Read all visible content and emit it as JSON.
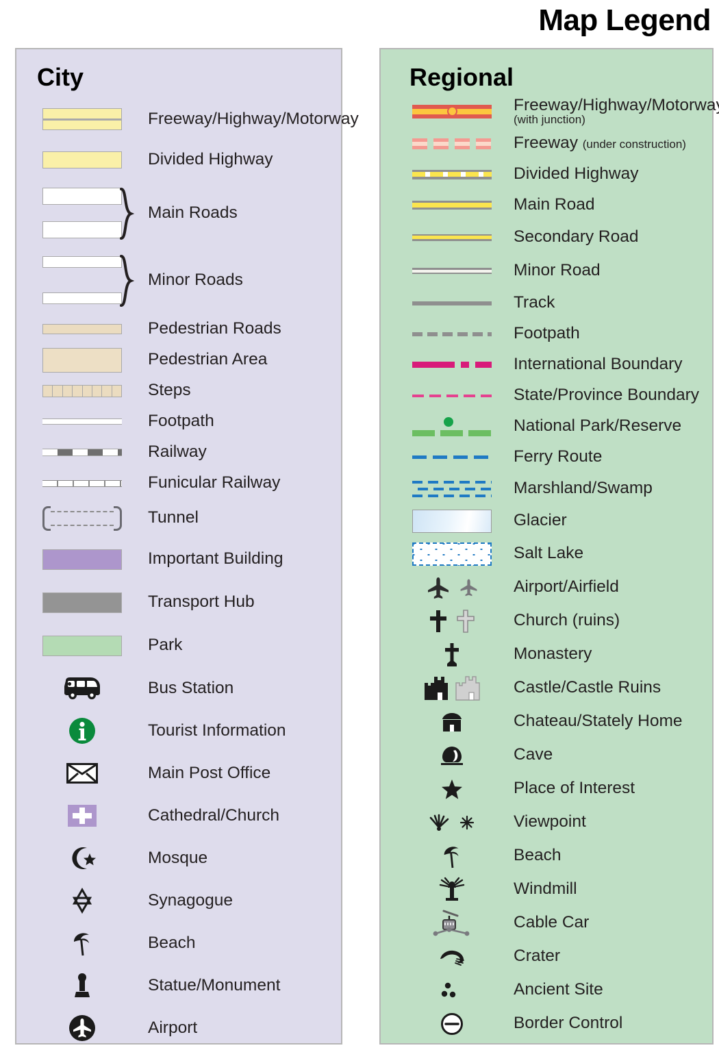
{
  "title": "Map Legend",
  "city": {
    "heading": "City",
    "items": [
      {
        "label": "Freeway/Highway/Motorway",
        "symbol": "band-freeway"
      },
      {
        "label": "Divided Highway",
        "symbol": "band-divided"
      },
      {
        "label": "Main Roads",
        "symbol": "main-roads-braced"
      },
      {
        "label": "Minor Roads",
        "symbol": "minor-roads-braced"
      },
      {
        "label": "Pedestrian Roads",
        "symbol": "band-pedroad"
      },
      {
        "label": "Pedestrian Area",
        "symbol": "band-pedarea"
      },
      {
        "label": "Steps",
        "symbol": "steps"
      },
      {
        "label": "Footpath",
        "symbol": "city-footpath"
      },
      {
        "label": "Railway",
        "symbol": "city-railway"
      },
      {
        "label": "Funicular Railway",
        "symbol": "city-funicular"
      },
      {
        "label": "Tunnel",
        "symbol": "tunnel"
      },
      {
        "label": "Important Building",
        "symbol": "band-purple"
      },
      {
        "label": "Transport Hub",
        "symbol": "band-gray"
      },
      {
        "label": "Park",
        "symbol": "band-green"
      },
      {
        "label": "Bus Station",
        "symbol": "bus-icon"
      },
      {
        "label": "Tourist Information",
        "symbol": "info-icon"
      },
      {
        "label": "Main Post Office",
        "symbol": "envelope-icon"
      },
      {
        "label": "Cathedral/Church",
        "symbol": "church-cross-icon"
      },
      {
        "label": "Mosque",
        "symbol": "mosque-icon"
      },
      {
        "label": "Synagogue",
        "symbol": "synagogue-icon"
      },
      {
        "label": "Beach",
        "symbol": "beach-icon"
      },
      {
        "label": "Statue/Monument",
        "symbol": "statue-icon"
      },
      {
        "label": "Airport",
        "symbol": "airport-icon"
      }
    ]
  },
  "regional": {
    "heading": "Regional",
    "items": [
      {
        "label": "Freeway/Highway/Motorway",
        "sublabel": "(with junction)",
        "sub_style": "second-line",
        "symbol": "r-freeway"
      },
      {
        "label": "Freeway",
        "sublabel": "(under construction)",
        "sub_style": "inline",
        "symbol": "r-freeway-uc"
      },
      {
        "label": "Divided Highway",
        "symbol": "r-divided"
      },
      {
        "label": "Main Road",
        "symbol": "r-main"
      },
      {
        "label": "Secondary Road",
        "symbol": "r-secondary"
      },
      {
        "label": "Minor Road",
        "symbol": "r-minor"
      },
      {
        "label": "Track",
        "symbol": "r-track"
      },
      {
        "label": "Footpath",
        "symbol": "r-footpath"
      },
      {
        "label": "International Boundary",
        "symbol": "r-intl"
      },
      {
        "label": "State/Province Boundary",
        "symbol": "r-state"
      },
      {
        "label": "National Park/Reserve",
        "symbol": "r-park"
      },
      {
        "label": "Ferry Route",
        "symbol": "r-ferry"
      },
      {
        "label": "Marshland/Swamp",
        "symbol": "r-marsh"
      },
      {
        "label": "Glacier",
        "symbol": "r-glacier"
      },
      {
        "label": "Salt Lake",
        "symbol": "r-salt"
      },
      {
        "label": "Airport/Airfield",
        "symbol": "airplane-pair-icon"
      },
      {
        "label": "Church (ruins)",
        "symbol": "cross-pair-icon"
      },
      {
        "label": "Monastery",
        "symbol": "monastery-cross-icon"
      },
      {
        "label": "Castle/Castle Ruins",
        "symbol": "castle-pair-icon"
      },
      {
        "label": "Chateau/Stately Home",
        "symbol": "chateau-icon"
      },
      {
        "label": "Cave",
        "symbol": "cave-icon"
      },
      {
        "label": "Place of Interest",
        "symbol": "star-icon"
      },
      {
        "label": "Viewpoint",
        "symbol": "viewpoint-pair-icon"
      },
      {
        "label": "Beach",
        "symbol": "beach-icon"
      },
      {
        "label": "Windmill",
        "symbol": "windmill-icon"
      },
      {
        "label": "Cable Car",
        "symbol": "cable-car-icon"
      },
      {
        "label": "Crater",
        "symbol": "crater-icon"
      },
      {
        "label": "Ancient Site",
        "symbol": "ancient-site-icon"
      },
      {
        "label": "Border Control",
        "symbol": "border-control-icon"
      }
    ]
  },
  "colors": {
    "city_panel_bg": "#dedcec",
    "regional_panel_bg": "#bfdfc5",
    "highway_yellow": "#faf0a8",
    "road_yellow": "#fbe54e",
    "freeway_red": "#e05a4f",
    "junction_orange": "#fcc63f",
    "pedestrian_tan": "#ebdcc0",
    "important_building_purple": "#ad96cc",
    "transport_hub_gray": "#949494",
    "park_green": "#b4dbb4",
    "info_green": "#0a8a3c",
    "intl_boundary_magenta": "#d81b7a",
    "state_boundary_pink": "#e5418f",
    "national_park_green": "#6cbe62",
    "ferry_blue": "#1f7ac4",
    "track_gray": "#8f8f8f"
  }
}
